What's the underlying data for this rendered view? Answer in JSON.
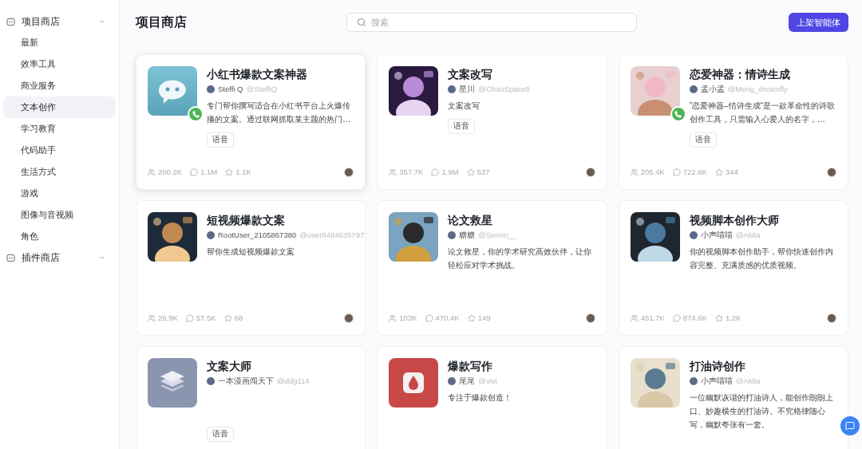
{
  "sidebar": {
    "sections": [
      {
        "label": "项目商店",
        "expanded": true,
        "children": [
          {
            "label": "最新",
            "selected": false
          },
          {
            "label": "效率工具",
            "selected": false
          },
          {
            "label": "商业服务",
            "selected": false
          },
          {
            "label": "文本创作",
            "selected": true
          },
          {
            "label": "学习教育",
            "selected": false
          },
          {
            "label": "代码助手",
            "selected": false
          },
          {
            "label": "生活方式",
            "selected": false
          },
          {
            "label": "游戏",
            "selected": false
          },
          {
            "label": "图像与音视频",
            "selected": false
          },
          {
            "label": "角色",
            "selected": false
          }
        ]
      },
      {
        "label": "插件商店",
        "expanded": false
      }
    ]
  },
  "header": {
    "title": "项目商店",
    "search": {
      "placeholder": "搜索"
    },
    "publish_button": "上架智能体"
  },
  "cards": [
    {
      "avatar": {
        "kind": "chat"
      },
      "title": "小红书爆款文案神器",
      "author": "Steffi Q",
      "handle": "@SteffiQ",
      "description": "专门帮你撰写适合在小红书平台上火爆传播的文案。通过联网抓取某主题的热门…",
      "tag": "语音",
      "call": true,
      "highlighted": true,
      "users": "200.2K",
      "comments": "1.1M",
      "stars_count": "1.1K"
    },
    {
      "title": "文案改写",
      "author": "星川",
      "handle": "@ChaoSpace9",
      "description": "文案改写",
      "tag": "语音",
      "call": false,
      "highlighted": false,
      "users": "357.7K",
      "comments": "1.9M",
      "stars_count": "537"
    },
    {
      "title": "恋爱神器：情诗生成",
      "author": "孟小孟",
      "handle": "@Meng_dreamfly",
      "description": "”恋爱神器–情诗生成“是一款革命性的诗歌创作工具，只需输入心爱人的名字，…",
      "tag": "语音",
      "call": true,
      "highlighted": false,
      "users": "205.4K",
      "comments": "722.6K",
      "stars_count": "344"
    },
    {
      "title": "短视频爆款文案",
      "author": "RootUser_2105867380",
      "handle": "@user8484635797",
      "description": "帮你生成短视频爆款文案",
      "call": false,
      "highlighted": false,
      "users": "26.9K",
      "comments": "57.5K",
      "stars_count": "68"
    },
    {
      "title": "论文救星",
      "author": "糖糖",
      "handle": "@Serein__",
      "description": "论文救星，你的学术研究高效伙伴，让你轻松应对学术挑战。",
      "call": false,
      "highlighted": false,
      "users": "103K",
      "comments": "470.4K",
      "stars_count": "149"
    },
    {
      "title": "视频脚本创作大师",
      "author": "小声喵喵",
      "handle": "@Akita",
      "description": "你的视频脚本创作助手，帮你快速创作内容完整、充满质感的优质视频。",
      "call": false,
      "highlighted": false,
      "users": "451.7K",
      "comments": "874.6K",
      "stars_count": "1.2K"
    },
    {
      "avatar": {
        "kind": "layers"
      },
      "title": "文案大师",
      "author": "一本漫画闯天下",
      "handle": "@ddg114",
      "tag": "语音",
      "call": false,
      "highlighted": false
    },
    {
      "avatar": {
        "kind": "drop"
      },
      "title": "爆款写作",
      "author": "尾尾",
      "handle": "@vivi",
      "description": "专注于爆款创造！",
      "call": false,
      "highlighted": false
    },
    {
      "title": "打油诗创作",
      "author": "小声喵喵",
      "handle": "@Akita",
      "description": "一位幽默诙谐的打油诗人，能创作朗朗上口、妙趣横生的打油诗。不究格律随心写，幽默夸张有一套。",
      "call": false,
      "highlighted": false
    }
  ]
}
